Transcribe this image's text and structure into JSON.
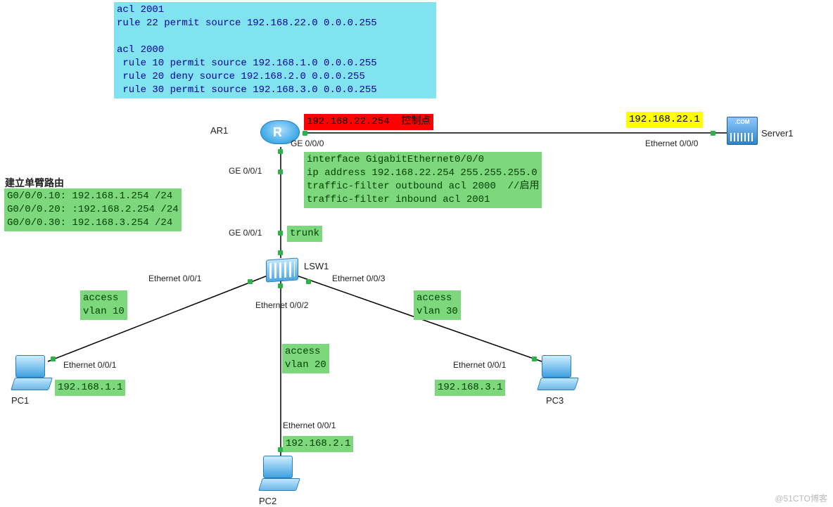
{
  "acl_block": "acl 2001\nrule 22 permit source 192.168.22.0 0.0.0.255\n\nacl 2000\n rule 10 permit source 192.168.1.0 0.0.0.255\n rule 20 deny source 192.168.2.0 0.0.0.255\n rule 30 permit source 192.168.3.0 0.0.0.255",
  "red_label": "192.168.22.254  控制点",
  "server_ip": "192.168.22.1",
  "iface_block": "interface GigabitEthernet0/0/0\nip address 192.168.22.254 255.255.255.0\ntraffic-filter outbound acl 2000  //启用\ntraffic-filter inbound acl 2001",
  "subif_title": "建立单臂路由",
  "subif_block": "G0/0/0.10: 192.168.1.254 /24\nG0/0/0.20: :192.168.2.254 /24\nG0/0/0.30: 192.168.3.254 /24",
  "trunk": "trunk",
  "access1": "access\nvlan 10",
  "access2": "access\nvlan 20",
  "access3": "access\nvlan 30",
  "pc1_ip": "192.168.1.1",
  "pc2_ip": "192.168.2.1",
  "pc3_ip": "192.168.3.1",
  "devices": {
    "ar1": "AR1",
    "lsw1": "LSW1",
    "pc1": "PC1",
    "pc2": "PC2",
    "pc3": "PC3",
    "server1": "Server1"
  },
  "ports": {
    "ar1_ge000": "GE 0/0/0",
    "ar1_ge001": "GE 0/0/1",
    "lsw1_ge001": "GE 0/0/1",
    "lsw1_e001": "Ethernet 0/0/1",
    "lsw1_e002": "Ethernet 0/0/2",
    "lsw1_e003": "Ethernet 0/0/3",
    "pc1_e001": "Ethernet 0/0/1",
    "pc2_e001": "Ethernet 0/0/1",
    "pc3_e001": "Ethernet 0/0/1",
    "srv_e001": "Ethernet 0/0/0"
  },
  "watermark": "@51CTO博客"
}
